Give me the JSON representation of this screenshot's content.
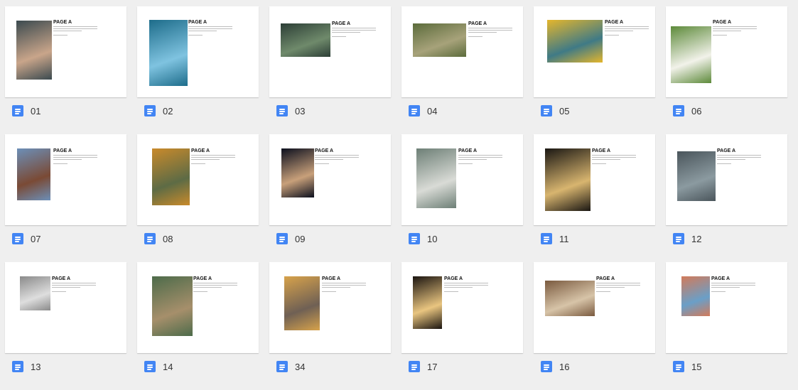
{
  "documents": [
    {
      "title": "01",
      "heading": "PAGE A",
      "image": "hand holding tiny shark",
      "colors": [
        "#3b4a4f",
        "#c9a58a"
      ]
    },
    {
      "title": "02",
      "heading": "PAGE A",
      "image": "waterfall through floor",
      "colors": [
        "#1d6c8a",
        "#7fc3e0"
      ]
    },
    {
      "title": "03",
      "heading": "PAGE A",
      "image": "green living room",
      "colors": [
        "#2c3e36",
        "#6f8a6b"
      ]
    },
    {
      "title": "04",
      "heading": "PAGE A",
      "image": "flooded forest",
      "colors": [
        "#5b6b3b",
        "#a7a27a"
      ]
    },
    {
      "title": "05",
      "heading": "PAGE A",
      "image": "yellow van tell this story",
      "colors": [
        "#e5b62c",
        "#3f7a86"
      ]
    },
    {
      "title": "06",
      "heading": "PAGE A",
      "image": "goose with ducklings",
      "colors": [
        "#5d8a3a",
        "#f2f2ea"
      ]
    },
    {
      "title": "07",
      "heading": "PAGE A",
      "image": "shark in house roof",
      "colors": [
        "#6c8fb8",
        "#7a4a35"
      ]
    },
    {
      "title": "08",
      "heading": "PAGE A",
      "image": "truck dumping leaves",
      "colors": [
        "#c98a2b",
        "#5d6b45"
      ]
    },
    {
      "title": "09",
      "heading": "PAGE A",
      "image": "ladder to sky door",
      "colors": [
        "#0b0f1e",
        "#c8a07a"
      ]
    },
    {
      "title": "10",
      "heading": "PAGE A",
      "image": "girl in snowy forest",
      "colors": [
        "#6d7f76",
        "#d9dbd6"
      ]
    },
    {
      "title": "11",
      "heading": "PAGE A",
      "image": "keyhole landscape",
      "colors": [
        "#1a1713",
        "#d8b56f"
      ]
    },
    {
      "title": "12",
      "heading": "PAGE A",
      "image": "warrior in misty ruins",
      "colors": [
        "#4a555b",
        "#8b9aa0"
      ]
    },
    {
      "title": "13",
      "heading": "PAGE A",
      "image": "grey ball machine",
      "colors": [
        "#8a8a8a",
        "#dedede"
      ]
    },
    {
      "title": "14",
      "heading": "PAGE A",
      "image": "figure on green bench",
      "colors": [
        "#4d6b4a",
        "#a68f6b"
      ]
    },
    {
      "title": "34",
      "heading": "PAGE A",
      "image": "floating island sunset",
      "colors": [
        "#d7a24b",
        "#6f6054"
      ]
    },
    {
      "title": "17",
      "heading": "PAGE A",
      "image": "moon pouring light",
      "colors": [
        "#1a1410",
        "#e9c580"
      ]
    },
    {
      "title": "16",
      "heading": "PAGE A",
      "image": "kitchen diorama",
      "colors": [
        "#7a5a3f",
        "#d7c4a8"
      ]
    },
    {
      "title": "15",
      "heading": "PAGE A",
      "image": "colorful crowd",
      "colors": [
        "#d27a5a",
        "#6a9fc8"
      ]
    }
  ]
}
